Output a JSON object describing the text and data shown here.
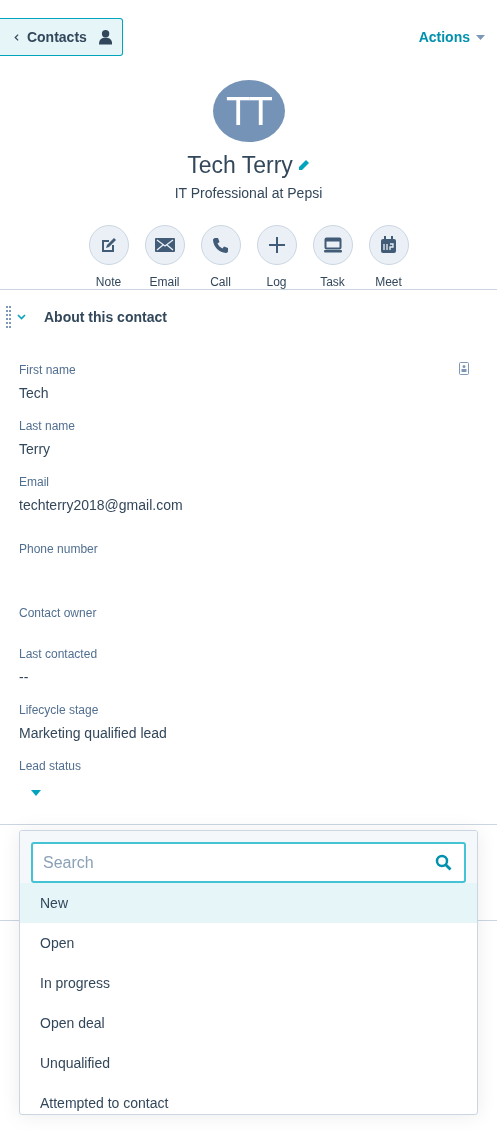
{
  "header": {
    "back_button": {
      "label": "Contacts"
    },
    "actions_menu": {
      "label": "Actions"
    }
  },
  "contact": {
    "initials": "TT",
    "name": "Tech Terry",
    "subtitle": "IT Professional at Pepsi"
  },
  "quick_actions": [
    {
      "kind": "note",
      "label": "Note"
    },
    {
      "kind": "email",
      "label": "Email"
    },
    {
      "kind": "call",
      "label": "Call"
    },
    {
      "kind": "log",
      "label": "Log"
    },
    {
      "kind": "task",
      "label": "Task"
    },
    {
      "kind": "meet",
      "label": "Meet"
    }
  ],
  "about_section": {
    "title": "About this contact",
    "expanded": true,
    "fields": [
      {
        "label": "First name",
        "value": "Tech"
      },
      {
        "label": "Last name",
        "value": "Terry"
      },
      {
        "label": "Email",
        "value": "techterry2018@gmail.com"
      },
      {
        "label": "Phone number"
      },
      {
        "label": "Contact owner"
      },
      {
        "label": "Last contacted",
        "value": "--"
      },
      {
        "label": "Lifecycle stage",
        "value": "Marketing qualified lead"
      },
      {
        "label": "Lead status",
        "kind": "dropdown"
      }
    ]
  },
  "lead_status_dropdown": {
    "search": {
      "placeholder": "Search"
    },
    "options": [
      {
        "label": "New",
        "selected": true
      },
      {
        "label": "Open",
        "selected": false
      },
      {
        "label": "In progress",
        "selected": false
      },
      {
        "label": "Open deal",
        "selected": false
      },
      {
        "label": "Unqualified",
        "selected": false
      },
      {
        "label": "Attempted to contact",
        "selected": false
      }
    ]
  }
}
